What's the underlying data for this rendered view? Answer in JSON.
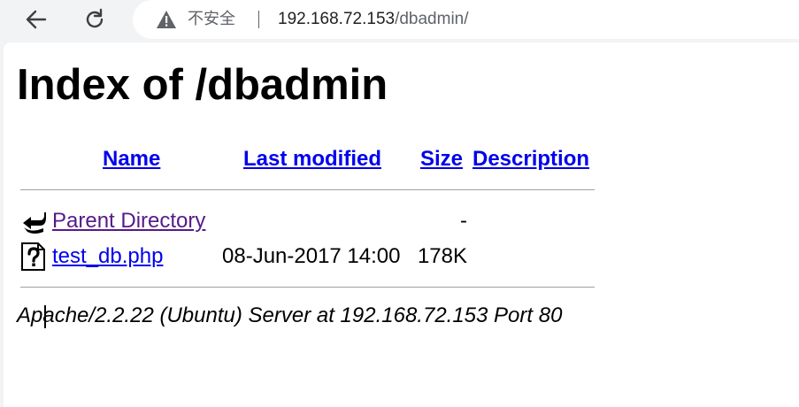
{
  "browser": {
    "security_label": "不安全",
    "url_host": "192.168.72.153",
    "url_path": "/dbadmin/"
  },
  "page": {
    "title": "Index of /dbadmin",
    "columns": {
      "name": "Name",
      "last_modified": "Last modified",
      "size": "Size",
      "description": "Description"
    },
    "rows": [
      {
        "icon": "back-arrow-icon",
        "name": "Parent Directory",
        "last_modified": "",
        "size": "-",
        "visited": true
      },
      {
        "icon": "unknown-file-icon",
        "name": "test_db.php",
        "last_modified": "08-Jun-2017 14:00",
        "size": "178K",
        "visited": false
      }
    ],
    "server_signature": "Apache/2.2.22 (Ubuntu) Server at 192.168.72.153 Port 80"
  },
  "colors": {
    "link": "#0000ee",
    "visited_link": "#551a8b",
    "chrome_bg": "#f1f3f4"
  }
}
